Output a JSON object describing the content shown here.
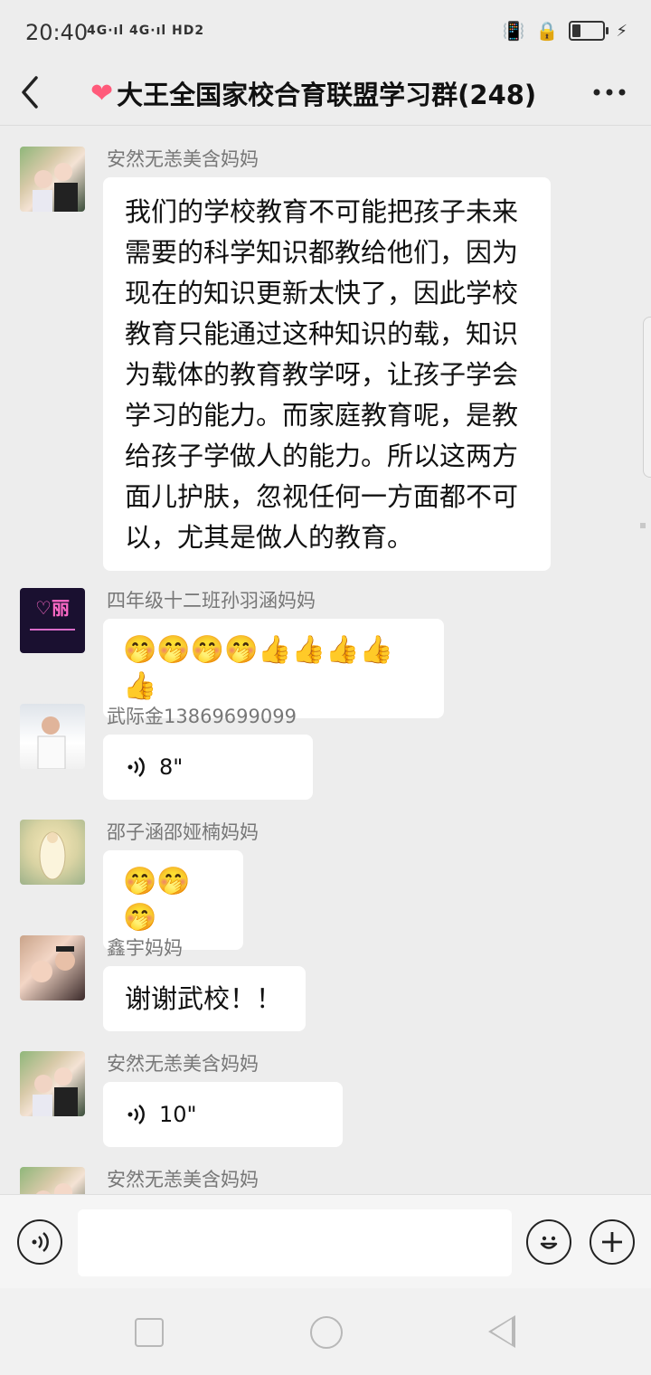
{
  "status": {
    "time": "20:40",
    "network": "4G·ıl 4G·ıl HD2",
    "battery_level": 0.3
  },
  "header": {
    "title": "大王全国家校合育联盟学习群(248)"
  },
  "messages": [
    {
      "sender": "安然无恙美含妈妈",
      "type": "text",
      "lines": [
        "我们的学校教育不可能把孩子未来",
        "需要的科学知识都教给他们，因为",
        "现在的知识更新太快了，因此学校",
        "教育只能通过这种知识的载，知识",
        "为载体的教育教学呀，让孩子学会",
        "学习的能力。而家庭教育呢，是教",
        "给孩子学做人的能力。所以这两方",
        "面儿护肤，忽视任何一方面都不可",
        "以，尤其是做人的教育。"
      ]
    },
    {
      "sender": "四年级十二班孙羽涵妈妈",
      "type": "emoji",
      "content": "🤭🤭🤭🤭👍👍👍👍👍",
      "avatar_text": "♡丽"
    },
    {
      "sender": "武际金13869699099",
      "type": "voice",
      "duration": "8\""
    },
    {
      "sender": "邵子涵邵娅楠妈妈",
      "type": "emoji",
      "content": "🤭🤭🤭"
    },
    {
      "sender": "鑫宇妈妈",
      "type": "text",
      "lines": [
        "谢谢武校！！"
      ]
    },
    {
      "sender": "安然无恙美含妈妈",
      "type": "voice",
      "duration": "10\""
    },
    {
      "sender": "安然无恙美含妈妈",
      "type": "partial"
    }
  ],
  "input": {
    "placeholder": ""
  },
  "colors": {
    "background": "#ededed",
    "bubble": "#ffffff",
    "heart": "#ff5a7a"
  }
}
